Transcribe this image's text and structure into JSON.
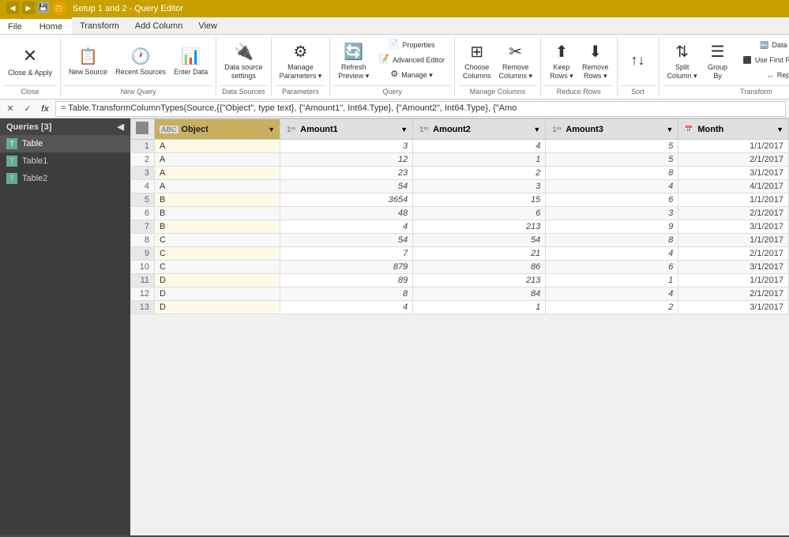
{
  "titlebar": {
    "title": "Setup 1 and 2 - Query Editor",
    "icons": [
      "◀",
      "▶"
    ]
  },
  "tabs": {
    "file": "File",
    "home": "Home",
    "transform": "Transform",
    "add_column": "Add Column",
    "view": "View"
  },
  "ribbon": {
    "groups": {
      "close": {
        "label": "Close",
        "close_apply": "Close &\nApply"
      },
      "new_query": {
        "label": "New Query",
        "new_source": "New\nSource",
        "recent_sources": "Recent\nSources",
        "enter_data": "Enter\nData"
      },
      "data_sources": {
        "label": "Data Sources",
        "data_source_settings": "Data source\nsettings"
      },
      "parameters": {
        "label": "Parameters",
        "manage_parameters": "Manage\nParameters"
      },
      "query": {
        "label": "Query",
        "refresh_preview": "Refresh\nPreview",
        "properties": "Properties",
        "advanced_editor": "Advanced Editor",
        "manage": "Manage ▾"
      },
      "manage_columns": {
        "label": "Manage Columns",
        "choose_columns": "Choose\nColumns",
        "remove_columns": "Remove\nColumns"
      },
      "reduce_rows": {
        "label": "Reduce Rows",
        "keep_rows": "Keep\nRows",
        "remove_rows": "Remove\nRows"
      },
      "sort": {
        "label": "Sort"
      },
      "transform": {
        "label": "Transform",
        "data_type": "Data Type: Text ▾",
        "first_row": "Use First Row As Headers ▾",
        "replace_values": "Replace Values",
        "split_column": "Split\nColumn",
        "group_by": "Group\nBy"
      }
    }
  },
  "formula_bar": {
    "cancel_icon": "✕",
    "accept_icon": "✓",
    "fx_icon": "fx",
    "formula": "= Table.TransformColumnTypes(Source,{{\"Object\", type text}, {\"Amount1\", Int64.Type}, {\"Amount2\", Int64.Type}, {\"Amo"
  },
  "sidebar": {
    "title": "Queries [3]",
    "collapse_icon": "◀",
    "items": [
      {
        "name": "Table",
        "active": true
      },
      {
        "name": "Table1",
        "active": false
      },
      {
        "name": "Table2",
        "active": false
      }
    ]
  },
  "grid": {
    "columns": [
      {
        "name": "Object",
        "type": "ABC",
        "selected": true
      },
      {
        "name": "Amount1",
        "type": "123"
      },
      {
        "name": "Amount2",
        "type": "123"
      },
      {
        "name": "Amount3",
        "type": "123"
      },
      {
        "name": "Month",
        "type": "CAL"
      }
    ],
    "rows": [
      {
        "num": 1,
        "Object": "A",
        "Amount1": "3",
        "Amount2": "4",
        "Amount3": "5",
        "Month": "1/1/2017"
      },
      {
        "num": 2,
        "Object": "A",
        "Amount1": "12",
        "Amount2": "1",
        "Amount3": "5",
        "Month": "2/1/2017"
      },
      {
        "num": 3,
        "Object": "A",
        "Amount1": "23",
        "Amount2": "2",
        "Amount3": "8",
        "Month": "3/1/2017"
      },
      {
        "num": 4,
        "Object": "A",
        "Amount1": "54",
        "Amount2": "3",
        "Amount3": "4",
        "Month": "4/1/2017"
      },
      {
        "num": 5,
        "Object": "B",
        "Amount1": "3654",
        "Amount2": "15",
        "Amount3": "6",
        "Month": "1/1/2017"
      },
      {
        "num": 6,
        "Object": "B",
        "Amount1": "48",
        "Amount2": "6",
        "Amount3": "3",
        "Month": "2/1/2017"
      },
      {
        "num": 7,
        "Object": "B",
        "Amount1": "4",
        "Amount2": "213",
        "Amount3": "9",
        "Month": "3/1/2017"
      },
      {
        "num": 8,
        "Object": "C",
        "Amount1": "54",
        "Amount2": "54",
        "Amount3": "8",
        "Month": "1/1/2017"
      },
      {
        "num": 9,
        "Object": "C",
        "Amount1": "7",
        "Amount2": "21",
        "Amount3": "4",
        "Month": "2/1/2017"
      },
      {
        "num": 10,
        "Object": "C",
        "Amount1": "879",
        "Amount2": "86",
        "Amount3": "6",
        "Month": "3/1/2017"
      },
      {
        "num": 11,
        "Object": "D",
        "Amount1": "89",
        "Amount2": "213",
        "Amount3": "1",
        "Month": "1/1/2017"
      },
      {
        "num": 12,
        "Object": "D",
        "Amount1": "8",
        "Amount2": "84",
        "Amount3": "4",
        "Month": "2/1/2017"
      },
      {
        "num": 13,
        "Object": "D",
        "Amount1": "4",
        "Amount2": "1",
        "Amount3": "2",
        "Month": "3/1/2017"
      }
    ]
  }
}
